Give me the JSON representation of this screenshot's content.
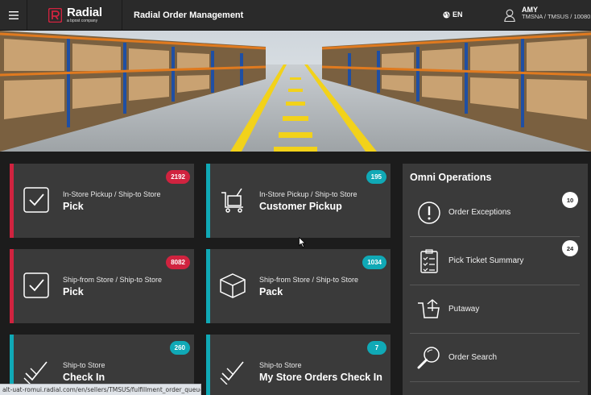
{
  "header": {
    "brand_name": "Radial",
    "brand_sub": "a bpost company",
    "title": "Radial Order Management",
    "lang": "EN",
    "user_name": "AMY",
    "user_org": "TMSNA / TMSUS / 100801"
  },
  "tiles": [
    {
      "sub": "In-Store Pickup / Ship-to Store",
      "main": "Pick",
      "badge": "2192",
      "color": "red",
      "icon": "checkbox-icon"
    },
    {
      "sub": "In-Store Pickup / Ship-to Store",
      "main": "Customer Pickup",
      "badge": "195",
      "color": "teal",
      "icon": "cart-icon"
    },
    {
      "sub": "Ship-from Store / Ship-to Store",
      "main": "Pick",
      "badge": "8082",
      "color": "red",
      "icon": "checkbox-icon"
    },
    {
      "sub": "Ship-from Store / Ship-to Store",
      "main": "Pack",
      "badge": "1034",
      "color": "teal",
      "icon": "box-icon"
    },
    {
      "sub": "Ship-to Store",
      "main": "Check In",
      "badge": "260",
      "color": "teal",
      "icon": "check-in-icon"
    },
    {
      "sub": "Ship-to Store",
      "main": "My Store Orders Check In",
      "badge": "7",
      "color": "teal",
      "icon": "check-in-icon"
    }
  ],
  "omni": {
    "title": "Omni Operations",
    "items": [
      {
        "label": "Order Exceptions",
        "badge": "10",
        "icon": "exclamation-icon"
      },
      {
        "label": "Pick Ticket Summary",
        "badge": "24",
        "icon": "clipboard-icon"
      },
      {
        "label": "Putaway",
        "badge": "",
        "icon": "putaway-icon"
      },
      {
        "label": "Order Search",
        "badge": "",
        "icon": "search-icon"
      }
    ]
  },
  "status_url": "alt-uat-romui.radial.com/en/sellers/TMSUS/fulfillment_order_queue_group...",
  "colors": {
    "red": "#d0233f",
    "teal": "#10a9b6",
    "header": "#2a2a2a",
    "tile": "#3a3a3a"
  }
}
